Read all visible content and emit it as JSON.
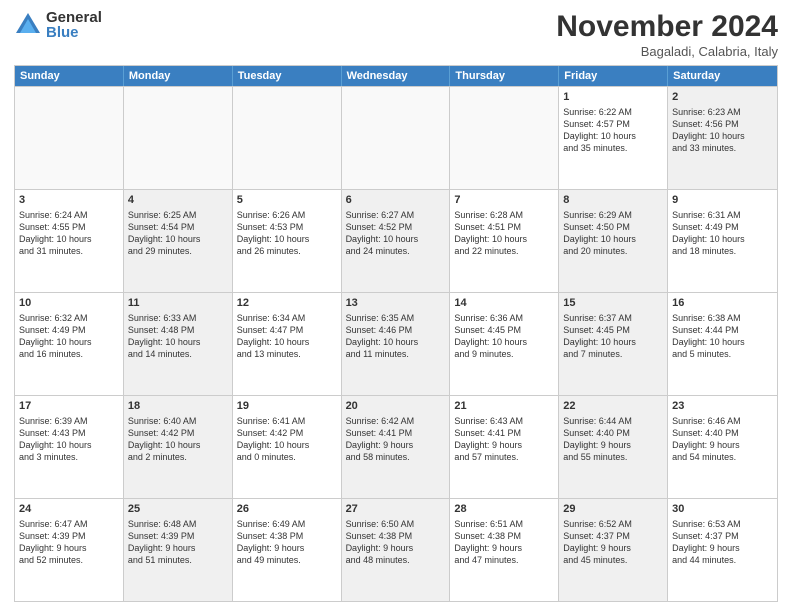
{
  "logo": {
    "general": "General",
    "blue": "Blue"
  },
  "header": {
    "month": "November 2024",
    "location": "Bagaladi, Calabria, Italy"
  },
  "weekdays": [
    "Sunday",
    "Monday",
    "Tuesday",
    "Wednesday",
    "Thursday",
    "Friday",
    "Saturday"
  ],
  "rows": [
    [
      {
        "day": "",
        "lines": [],
        "empty": true
      },
      {
        "day": "",
        "lines": [],
        "empty": true
      },
      {
        "day": "",
        "lines": [],
        "empty": true
      },
      {
        "day": "",
        "lines": [],
        "empty": true
      },
      {
        "day": "",
        "lines": [],
        "empty": true
      },
      {
        "day": "1",
        "lines": [
          "Sunrise: 6:22 AM",
          "Sunset: 4:57 PM",
          "Daylight: 10 hours",
          "and 35 minutes."
        ],
        "empty": false
      },
      {
        "day": "2",
        "lines": [
          "Sunrise: 6:23 AM",
          "Sunset: 4:56 PM",
          "Daylight: 10 hours",
          "and 33 minutes."
        ],
        "empty": false,
        "shaded": true
      }
    ],
    [
      {
        "day": "3",
        "lines": [
          "Sunrise: 6:24 AM",
          "Sunset: 4:55 PM",
          "Daylight: 10 hours",
          "and 31 minutes."
        ],
        "empty": false
      },
      {
        "day": "4",
        "lines": [
          "Sunrise: 6:25 AM",
          "Sunset: 4:54 PM",
          "Daylight: 10 hours",
          "and 29 minutes."
        ],
        "empty": false,
        "shaded": true
      },
      {
        "day": "5",
        "lines": [
          "Sunrise: 6:26 AM",
          "Sunset: 4:53 PM",
          "Daylight: 10 hours",
          "and 26 minutes."
        ],
        "empty": false
      },
      {
        "day": "6",
        "lines": [
          "Sunrise: 6:27 AM",
          "Sunset: 4:52 PM",
          "Daylight: 10 hours",
          "and 24 minutes."
        ],
        "empty": false,
        "shaded": true
      },
      {
        "day": "7",
        "lines": [
          "Sunrise: 6:28 AM",
          "Sunset: 4:51 PM",
          "Daylight: 10 hours",
          "and 22 minutes."
        ],
        "empty": false
      },
      {
        "day": "8",
        "lines": [
          "Sunrise: 6:29 AM",
          "Sunset: 4:50 PM",
          "Daylight: 10 hours",
          "and 20 minutes."
        ],
        "empty": false,
        "shaded": true
      },
      {
        "day": "9",
        "lines": [
          "Sunrise: 6:31 AM",
          "Sunset: 4:49 PM",
          "Daylight: 10 hours",
          "and 18 minutes."
        ],
        "empty": false
      }
    ],
    [
      {
        "day": "10",
        "lines": [
          "Sunrise: 6:32 AM",
          "Sunset: 4:49 PM",
          "Daylight: 10 hours",
          "and 16 minutes."
        ],
        "empty": false
      },
      {
        "day": "11",
        "lines": [
          "Sunrise: 6:33 AM",
          "Sunset: 4:48 PM",
          "Daylight: 10 hours",
          "and 14 minutes."
        ],
        "empty": false,
        "shaded": true
      },
      {
        "day": "12",
        "lines": [
          "Sunrise: 6:34 AM",
          "Sunset: 4:47 PM",
          "Daylight: 10 hours",
          "and 13 minutes."
        ],
        "empty": false
      },
      {
        "day": "13",
        "lines": [
          "Sunrise: 6:35 AM",
          "Sunset: 4:46 PM",
          "Daylight: 10 hours",
          "and 11 minutes."
        ],
        "empty": false,
        "shaded": true
      },
      {
        "day": "14",
        "lines": [
          "Sunrise: 6:36 AM",
          "Sunset: 4:45 PM",
          "Daylight: 10 hours",
          "and 9 minutes."
        ],
        "empty": false
      },
      {
        "day": "15",
        "lines": [
          "Sunrise: 6:37 AM",
          "Sunset: 4:45 PM",
          "Daylight: 10 hours",
          "and 7 minutes."
        ],
        "empty": false,
        "shaded": true
      },
      {
        "day": "16",
        "lines": [
          "Sunrise: 6:38 AM",
          "Sunset: 4:44 PM",
          "Daylight: 10 hours",
          "and 5 minutes."
        ],
        "empty": false
      }
    ],
    [
      {
        "day": "17",
        "lines": [
          "Sunrise: 6:39 AM",
          "Sunset: 4:43 PM",
          "Daylight: 10 hours",
          "and 3 minutes."
        ],
        "empty": false
      },
      {
        "day": "18",
        "lines": [
          "Sunrise: 6:40 AM",
          "Sunset: 4:42 PM",
          "Daylight: 10 hours",
          "and 2 minutes."
        ],
        "empty": false,
        "shaded": true
      },
      {
        "day": "19",
        "lines": [
          "Sunrise: 6:41 AM",
          "Sunset: 4:42 PM",
          "Daylight: 10 hours",
          "and 0 minutes."
        ],
        "empty": false
      },
      {
        "day": "20",
        "lines": [
          "Sunrise: 6:42 AM",
          "Sunset: 4:41 PM",
          "Daylight: 9 hours",
          "and 58 minutes."
        ],
        "empty": false,
        "shaded": true
      },
      {
        "day": "21",
        "lines": [
          "Sunrise: 6:43 AM",
          "Sunset: 4:41 PM",
          "Daylight: 9 hours",
          "and 57 minutes."
        ],
        "empty": false
      },
      {
        "day": "22",
        "lines": [
          "Sunrise: 6:44 AM",
          "Sunset: 4:40 PM",
          "Daylight: 9 hours",
          "and 55 minutes."
        ],
        "empty": false,
        "shaded": true
      },
      {
        "day": "23",
        "lines": [
          "Sunrise: 6:46 AM",
          "Sunset: 4:40 PM",
          "Daylight: 9 hours",
          "and 54 minutes."
        ],
        "empty": false
      }
    ],
    [
      {
        "day": "24",
        "lines": [
          "Sunrise: 6:47 AM",
          "Sunset: 4:39 PM",
          "Daylight: 9 hours",
          "and 52 minutes."
        ],
        "empty": false
      },
      {
        "day": "25",
        "lines": [
          "Sunrise: 6:48 AM",
          "Sunset: 4:39 PM",
          "Daylight: 9 hours",
          "and 51 minutes."
        ],
        "empty": false,
        "shaded": true
      },
      {
        "day": "26",
        "lines": [
          "Sunrise: 6:49 AM",
          "Sunset: 4:38 PM",
          "Daylight: 9 hours",
          "and 49 minutes."
        ],
        "empty": false
      },
      {
        "day": "27",
        "lines": [
          "Sunrise: 6:50 AM",
          "Sunset: 4:38 PM",
          "Daylight: 9 hours",
          "and 48 minutes."
        ],
        "empty": false,
        "shaded": true
      },
      {
        "day": "28",
        "lines": [
          "Sunrise: 6:51 AM",
          "Sunset: 4:38 PM",
          "Daylight: 9 hours",
          "and 47 minutes."
        ],
        "empty": false
      },
      {
        "day": "29",
        "lines": [
          "Sunrise: 6:52 AM",
          "Sunset: 4:37 PM",
          "Daylight: 9 hours",
          "and 45 minutes."
        ],
        "empty": false,
        "shaded": true
      },
      {
        "day": "30",
        "lines": [
          "Sunrise: 6:53 AM",
          "Sunset: 4:37 PM",
          "Daylight: 9 hours",
          "and 44 minutes."
        ],
        "empty": false
      }
    ]
  ]
}
